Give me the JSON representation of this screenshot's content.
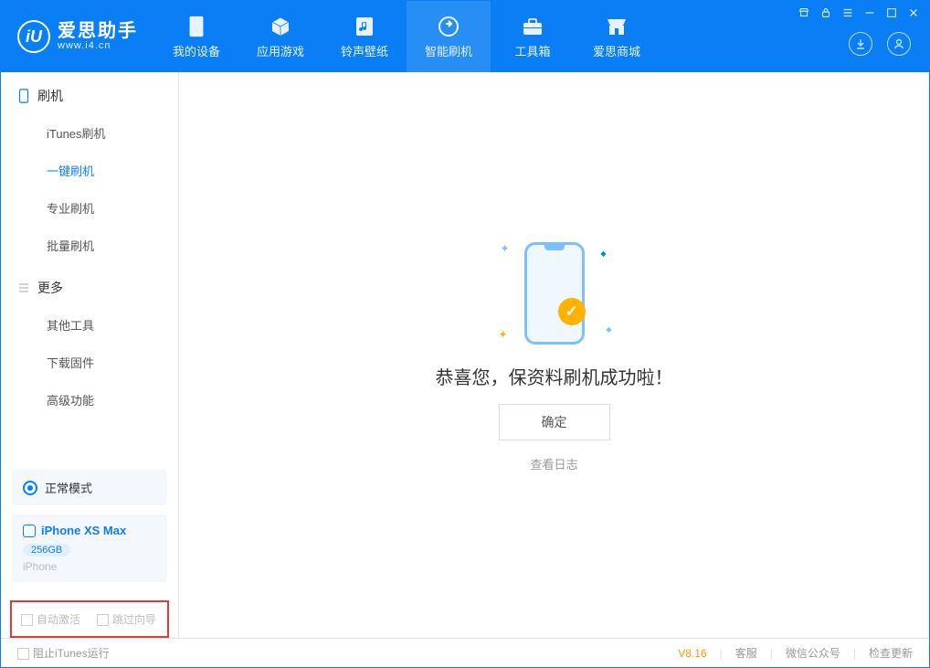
{
  "app": {
    "title_cn": "爱思助手",
    "url": "www.i4.cn",
    "logo_letter": "iU"
  },
  "topbar_icons": [
    "tshirt-icon",
    "lock-icon",
    "menu-icon",
    "minimize-icon",
    "maximize-icon",
    "close-icon"
  ],
  "nav": {
    "tabs": [
      {
        "label": "我的设备",
        "icon": "device-icon"
      },
      {
        "label": "应用游戏",
        "icon": "cube-icon"
      },
      {
        "label": "铃声壁纸",
        "icon": "music-icon"
      },
      {
        "label": "智能刷机",
        "icon": "refresh-icon",
        "active": true
      },
      {
        "label": "工具箱",
        "icon": "toolbox-icon"
      },
      {
        "label": "爱思商城",
        "icon": "shop-icon"
      }
    ]
  },
  "sidebar": {
    "section1_title": "刷机",
    "section1_items": [
      "iTunes刷机",
      "一键刷机",
      "专业刷机",
      "批量刷机"
    ],
    "selected_index": 1,
    "section2_title": "更多",
    "section2_items": [
      "其他工具",
      "下载固件",
      "高级功能"
    ]
  },
  "device_panel": {
    "mode": "正常模式",
    "device_name": "iPhone XS Max",
    "storage": "256GB",
    "type": "iPhone"
  },
  "options": {
    "auto_activate": "自动激活",
    "skip_guide": "跳过向导"
  },
  "main": {
    "success_message": "恭喜您，保资料刷机成功啦！",
    "confirm_button": "确定",
    "view_log": "查看日志"
  },
  "footer": {
    "stop_itunes": "阻止iTunes运行",
    "version": "V8.16",
    "links": [
      "客服",
      "微信公众号",
      "检查更新"
    ]
  }
}
